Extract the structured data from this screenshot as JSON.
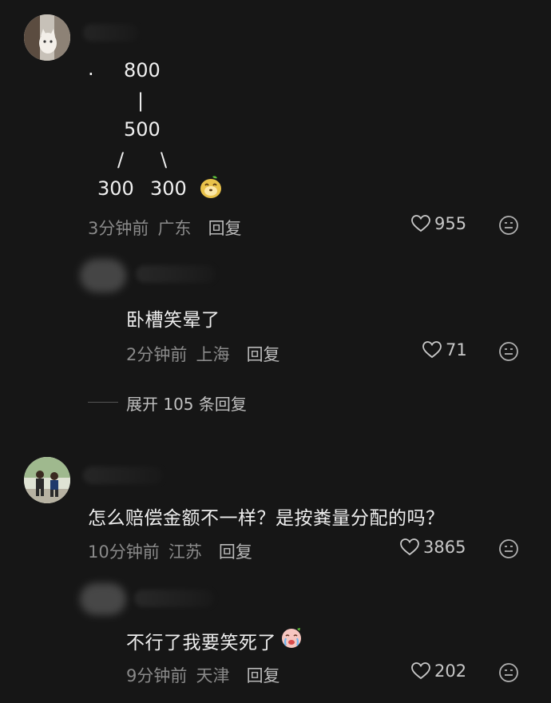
{
  "comments": [
    {
      "tree_lines": [
        "800",
        "|",
        "500",
        "/",
        "\\",
        "300",
        "300"
      ],
      "dot": ".",
      "time": "3分钟前",
      "location": "广东",
      "reply_label": "回复",
      "likes": "955",
      "emoji_icon": "dog-emoji-icon"
    },
    {
      "text": "卧槽笑晕了",
      "time": "2分钟前",
      "location": "上海",
      "reply_label": "回复",
      "likes": "71"
    },
    {
      "text": "怎么赔偿金额不一样？是按粪量分配的吗？",
      "time": "10分钟前",
      "location": "江苏",
      "reply_label": "回复",
      "likes": "3865"
    },
    {
      "text": "不行了我要笑死了",
      "time": "9分钟前",
      "location": "天津",
      "reply_label": "回复",
      "likes": "202",
      "emoji_icon": "crying-emoji-icon"
    }
  ],
  "expand_replies": "展开 105 条回复"
}
